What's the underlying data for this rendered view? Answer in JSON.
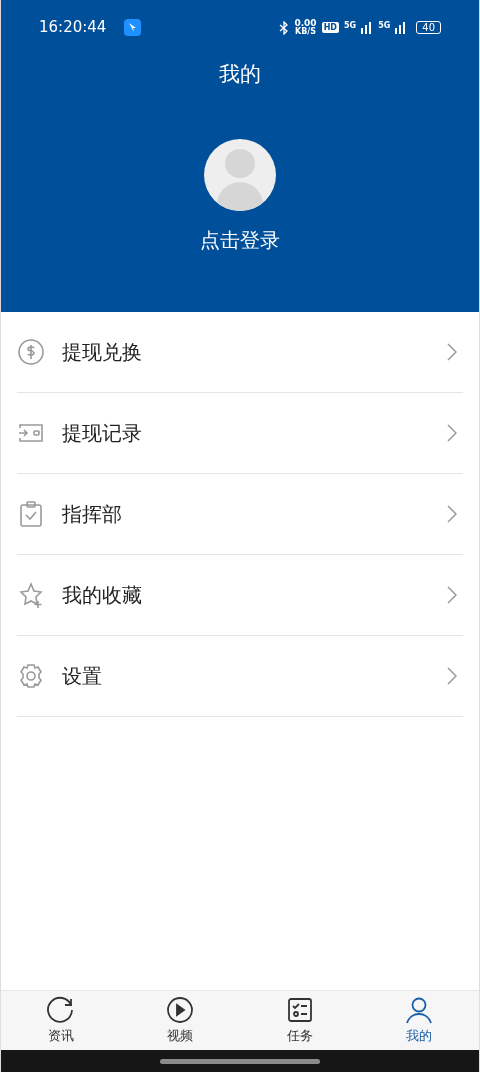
{
  "status_bar": {
    "time": "16:20:44",
    "net_speed": "0.00",
    "net_unit": "KB/S",
    "hd": "HD",
    "signal_1": "5G",
    "signal_2": "5G",
    "battery": "40"
  },
  "header": {
    "title": "我的",
    "login": "点击登录"
  },
  "menu": [
    {
      "kind": "coin",
      "label": "提现兑换"
    },
    {
      "kind": "wallet",
      "label": "提现记录"
    },
    {
      "kind": "clipboard",
      "label": "指挥部"
    },
    {
      "kind": "star",
      "label": "我的收藏"
    },
    {
      "kind": "gear",
      "label": "设置"
    }
  ],
  "tabs": [
    {
      "kind": "refresh",
      "label": "资讯",
      "selected": false
    },
    {
      "kind": "play",
      "label": "视频",
      "selected": false
    },
    {
      "kind": "tasks",
      "label": "任务",
      "selected": false
    },
    {
      "kind": "user",
      "label": "我的",
      "selected": true
    }
  ]
}
